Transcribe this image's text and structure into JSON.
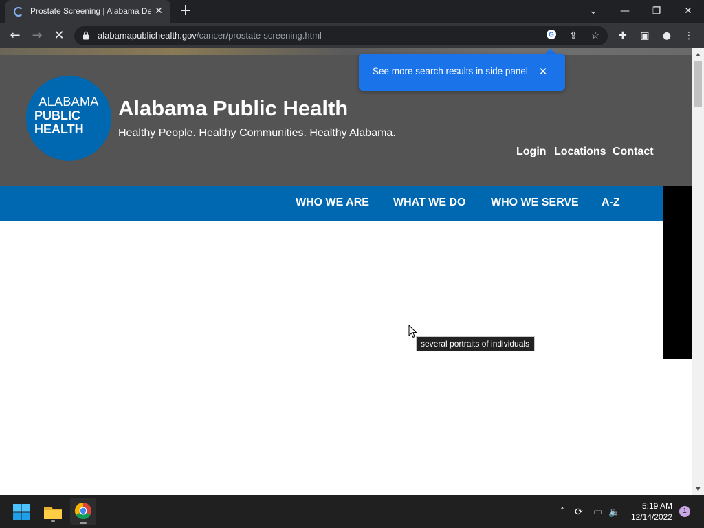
{
  "browser": {
    "tab_title": "Prostate Screening | Alabama De",
    "url_host": "alabamapublichealth.gov",
    "url_path": "/cancer/prostate-screening.html"
  },
  "promo": {
    "text": "See more search results in side panel"
  },
  "site": {
    "logo_line1": "ALABAMA",
    "logo_line2": "PUBLIC",
    "logo_line3": "HEALTH",
    "title": "Alabama Public Health",
    "tagline": "Healthy People. Healthy Communities. Healthy Alabama.",
    "utility_links": [
      "Login",
      "Locations",
      "Contact"
    ],
    "nav": [
      "WHO WE ARE",
      "WHAT WE DO",
      "WHO WE SERVE",
      "A-Z"
    ]
  },
  "tooltip": "several portraits of individuals",
  "taskbar": {
    "time": "5:19 AM",
    "date": "12/14/2022",
    "notification_count": "1"
  },
  "colors": {
    "header_bg": "#545454",
    "brand_blue": "#0067b1",
    "promo_blue": "#1a73e8"
  }
}
